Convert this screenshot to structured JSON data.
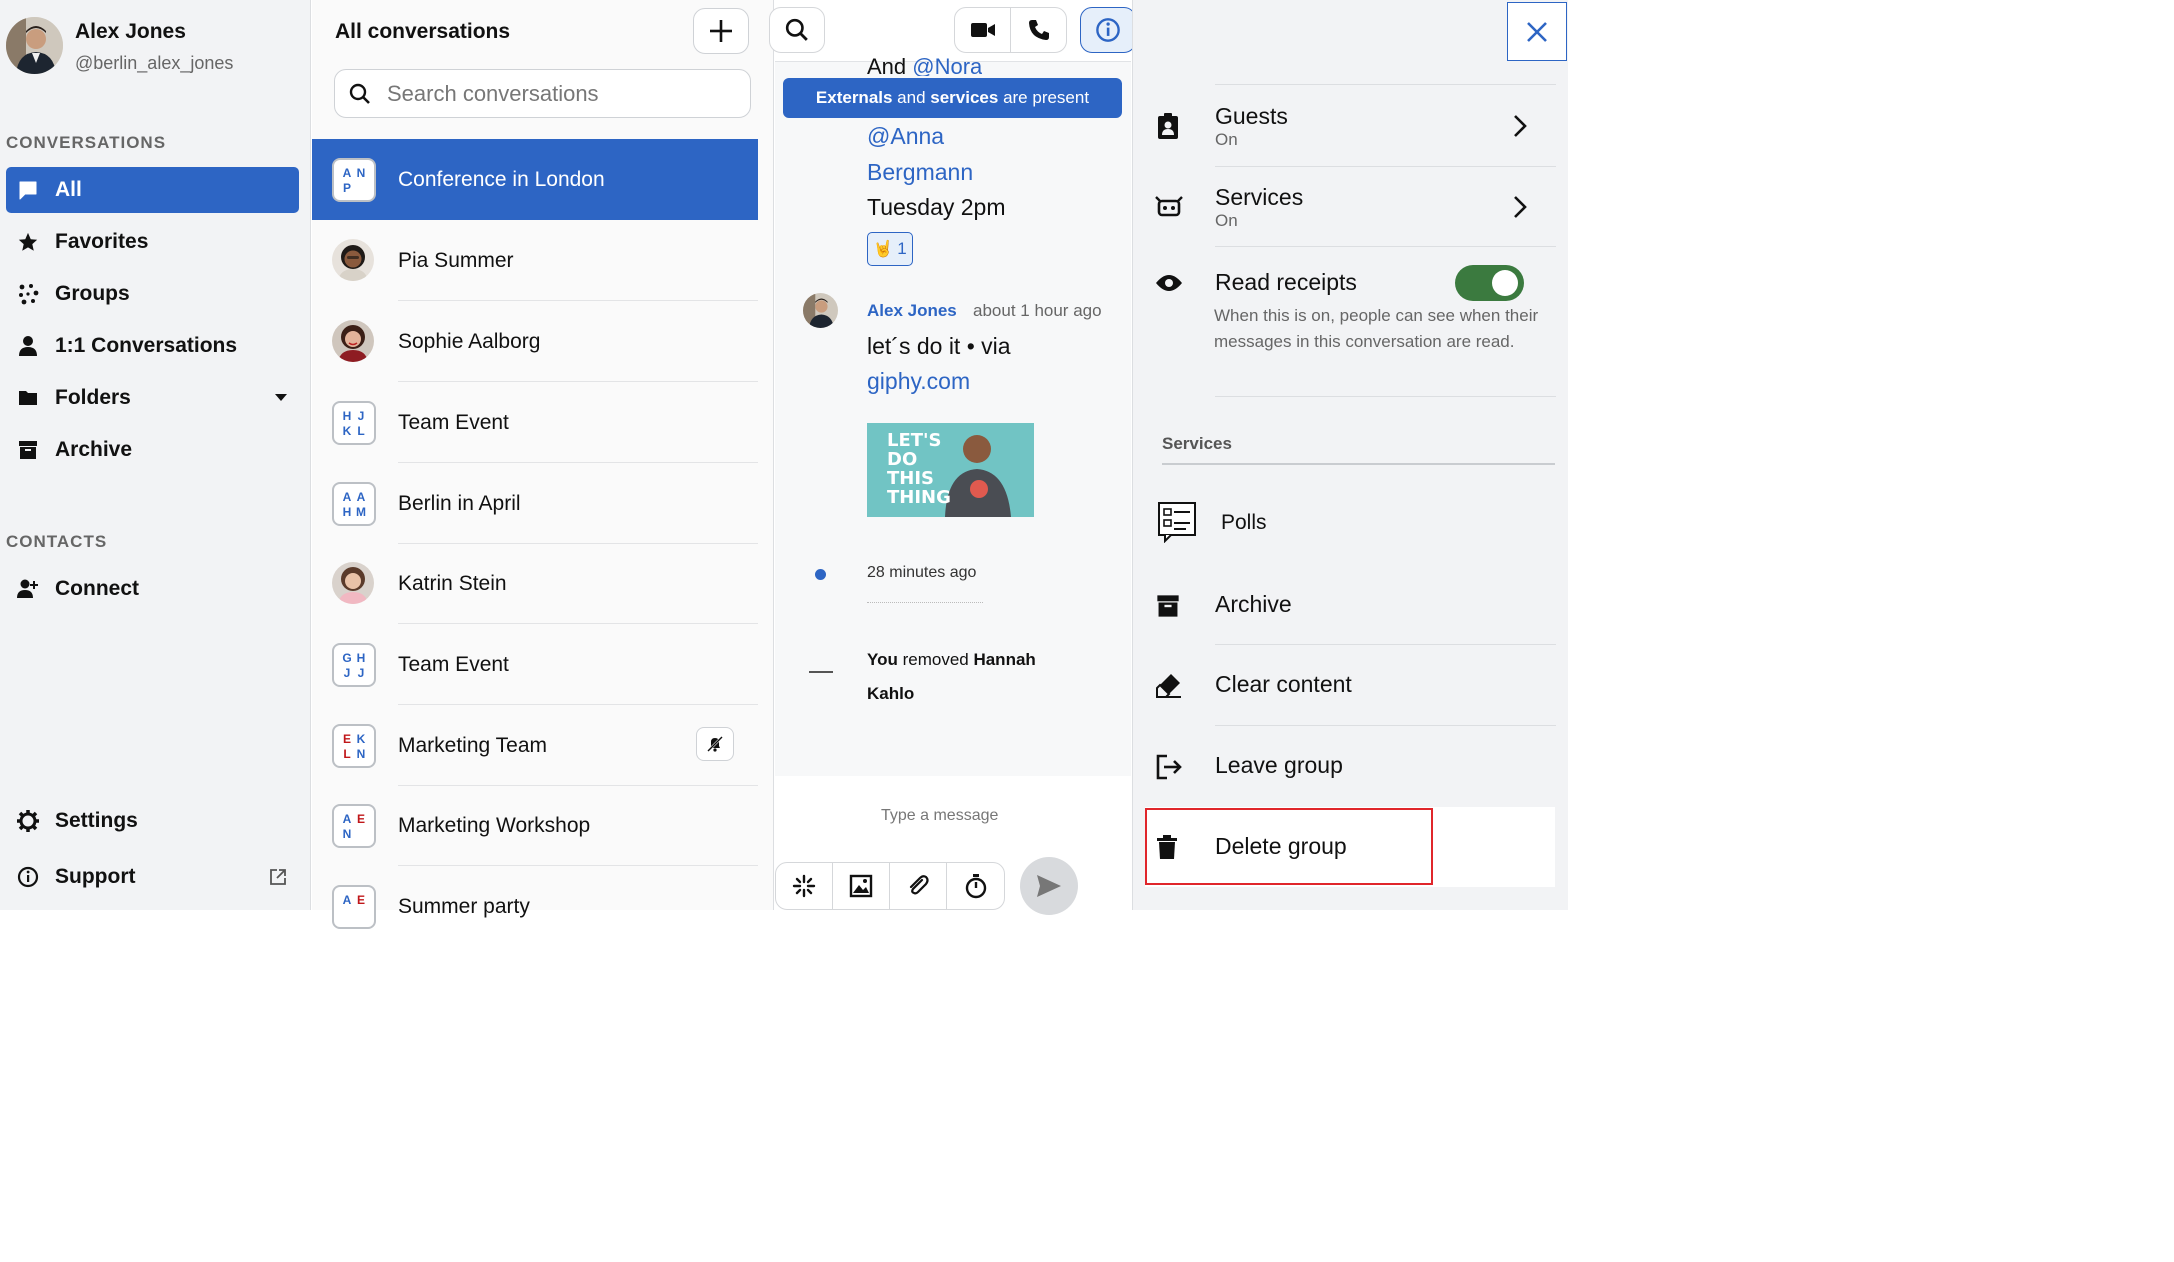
{
  "user": {
    "name": "Alex Jones",
    "handle": "@berlin_alex_jones"
  },
  "sidebar": {
    "conversations_heading": "CONVERSATIONS",
    "items": [
      {
        "label": "All",
        "icon": "chat-bubble-icon"
      },
      {
        "label": "Favorites",
        "icon": "star-icon"
      },
      {
        "label": "Groups",
        "icon": "groups-dots-icon"
      },
      {
        "label": "1:1 Conversations",
        "icon": "person-icon"
      },
      {
        "label": "Folders",
        "icon": "folder-icon"
      },
      {
        "label": "Archive",
        "icon": "archive-icon"
      }
    ],
    "contacts_heading": "CONTACTS",
    "connect_label": "Connect",
    "settings_label": "Settings",
    "support_label": "Support"
  },
  "list": {
    "title": "All conversations",
    "search_placeholder": "Search conversations",
    "conversations": [
      {
        "name": "Conference in London",
        "type": "group",
        "initials": [
          "A",
          "N",
          "P",
          ""
        ],
        "active": true
      },
      {
        "name": "Pia Summer",
        "type": "person"
      },
      {
        "name": "Sophie Aalborg",
        "type": "person"
      },
      {
        "name": "Team Event",
        "type": "group",
        "initials": [
          "H",
          "J",
          "K",
          "L"
        ]
      },
      {
        "name": "Berlin in April",
        "type": "group",
        "initials": [
          "A",
          "A",
          "H",
          "M"
        ]
      },
      {
        "name": "Katrin Stein",
        "type": "person"
      },
      {
        "name": "Team Event",
        "type": "group",
        "initials": [
          "G",
          "H",
          "J",
          "J"
        ]
      },
      {
        "name": "Marketing Team",
        "type": "group",
        "initials": [
          "E",
          "K",
          "L",
          "N"
        ],
        "muted": true
      },
      {
        "name": "Marketing Workshop",
        "type": "group",
        "initials": [
          "A",
          "E",
          "N",
          ""
        ]
      },
      {
        "name": "Summer party",
        "type": "group",
        "initials": [
          "A",
          "E",
          "",
          ""
        ]
      }
    ]
  },
  "chat": {
    "banner_part1": "Externals",
    "banner_part2": " and ",
    "banner_part3": "services",
    "banner_part4": " are present",
    "partial_text": "And ",
    "partial_mention": "@Nora",
    "mention_1": "@Anna",
    "mention_2": "Bergmann",
    "time_text": "Tuesday 2pm",
    "reaction_emoji": "🤘",
    "reaction_count": "1",
    "msg_author": "Alex Jones",
    "msg_time": "about 1 hour ago",
    "msg_text": "let´s do it • via",
    "msg_link": "giphy.com",
    "gif_text": "LET'S DO THIS THING",
    "system_time": "28 minutes ago",
    "removed_prefix": "You",
    "removed_mid": " removed ",
    "removed_name": "Hannah Kahlo",
    "input_placeholder": "Type a message"
  },
  "details": {
    "guests": {
      "title": "Guests",
      "status": "On"
    },
    "services": {
      "title": "Services",
      "status": "On"
    },
    "read_receipts": {
      "title": "Read receipts",
      "description": "When this is on, people can see when their messages in this conversation are read.",
      "enabled": true
    },
    "services_heading": "Services",
    "polls_label": "Polls",
    "archive_label": "Archive",
    "clear_label": "Clear content",
    "leave_label": "Leave group",
    "delete_label": "Delete group"
  },
  "colors": {
    "accent": "#2d65c4",
    "toggle": "#3b7a3f",
    "highlight": "#e0262b"
  }
}
